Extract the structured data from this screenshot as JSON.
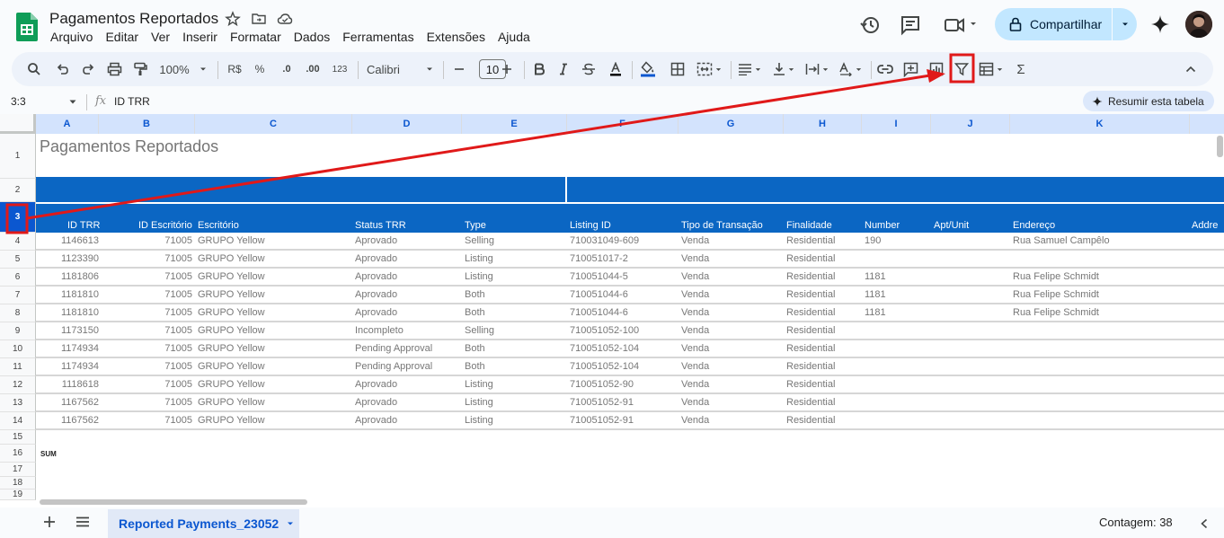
{
  "app": {
    "doc_title": "Pagamentos Reportados",
    "menu": [
      "Arquivo",
      "Editar",
      "Ver",
      "Inserir",
      "Formatar",
      "Dados",
      "Ferramentas",
      "Extensões",
      "Ajuda"
    ],
    "share_label": "Compartilhar"
  },
  "toolbar": {
    "zoom": "100%",
    "currency": "R$",
    "percent": "%",
    "dec_decrease": ".0",
    "dec_increase": ".00",
    "number_format": "123",
    "font": "Calibri",
    "font_size": "10",
    "sum_symbol": "Σ"
  },
  "formula_bar": {
    "cell_ref": "3:3",
    "fx": "fx",
    "content": "ID TRR",
    "summarize_label": "Resumir esta tabela"
  },
  "columns": [
    "A",
    "B",
    "C",
    "D",
    "E",
    "F",
    "G",
    "H",
    "I",
    "J",
    "K"
  ],
  "rows": [
    "1",
    "2",
    "3",
    "4",
    "5",
    "6",
    "7",
    "8",
    "9",
    "10",
    "11",
    "12",
    "13",
    "14",
    "15",
    "16",
    "17",
    "18",
    "19"
  ],
  "sheet": {
    "title": "Pagamentos Reportados",
    "headers": [
      "ID TRR",
      "ID Escritório",
      "Escritório",
      "Status TRR",
      "Type",
      "Listing ID",
      "Tipo de Transação",
      "Finalidade",
      "Number",
      "Apt/Unit",
      "Endereço",
      "Addre"
    ],
    "data": [
      [
        "1146613",
        "71005",
        "GRUPO Yellow",
        "Aprovado",
        "Selling",
        "710031049-609",
        "Venda",
        "Residential",
        "190",
        "",
        "Rua Samuel Campêlo"
      ],
      [
        "1123390",
        "71005",
        "GRUPO Yellow",
        "Aprovado",
        "Listing",
        "710051017-2",
        "Venda",
        "Residential",
        "",
        "",
        ""
      ],
      [
        "1181806",
        "71005",
        "GRUPO Yellow",
        "Aprovado",
        "Listing",
        "710051044-5",
        "Venda",
        "Residential",
        "1181",
        "",
        "Rua Felipe Schmidt"
      ],
      [
        "1181810",
        "71005",
        "GRUPO Yellow",
        "Aprovado",
        "Both",
        "710051044-6",
        "Venda",
        "Residential",
        "1181",
        "",
        "Rua Felipe Schmidt"
      ],
      [
        "1181810",
        "71005",
        "GRUPO Yellow",
        "Aprovado",
        "Both",
        "710051044-6",
        "Venda",
        "Residential",
        "1181",
        "",
        "Rua Felipe Schmidt"
      ],
      [
        "1173150",
        "71005",
        "GRUPO Yellow",
        "Incompleto",
        "Selling",
        "710051052-100",
        "Venda",
        "Residential",
        "",
        "",
        ""
      ],
      [
        "1174934",
        "71005",
        "GRUPO Yellow",
        "Pending Approval",
        "Both",
        "710051052-104",
        "Venda",
        "Residential",
        "",
        "",
        ""
      ],
      [
        "1174934",
        "71005",
        "GRUPO Yellow",
        "Pending Approval",
        "Both",
        "710051052-104",
        "Venda",
        "Residential",
        "",
        "",
        ""
      ],
      [
        "1118618",
        "71005",
        "GRUPO Yellow",
        "Aprovado",
        "Listing",
        "710051052-90",
        "Venda",
        "Residential",
        "",
        "",
        ""
      ],
      [
        "1167562",
        "71005",
        "GRUPO Yellow",
        "Aprovado",
        "Listing",
        "710051052-91",
        "Venda",
        "Residential",
        "",
        "",
        ""
      ],
      [
        "1167562",
        "71005",
        "GRUPO Yellow",
        "Aprovado",
        "Listing",
        "710051052-91",
        "Venda",
        "Residential",
        "",
        "",
        ""
      ]
    ],
    "sum_label": "SUM"
  },
  "bottom": {
    "sheet_tab": "Reported Payments_23052",
    "count": "Contagem: 38"
  },
  "colors": {
    "header_blue": "#0b66c3",
    "annotation_red": "#e01919",
    "accent": "#0b57d0"
  }
}
